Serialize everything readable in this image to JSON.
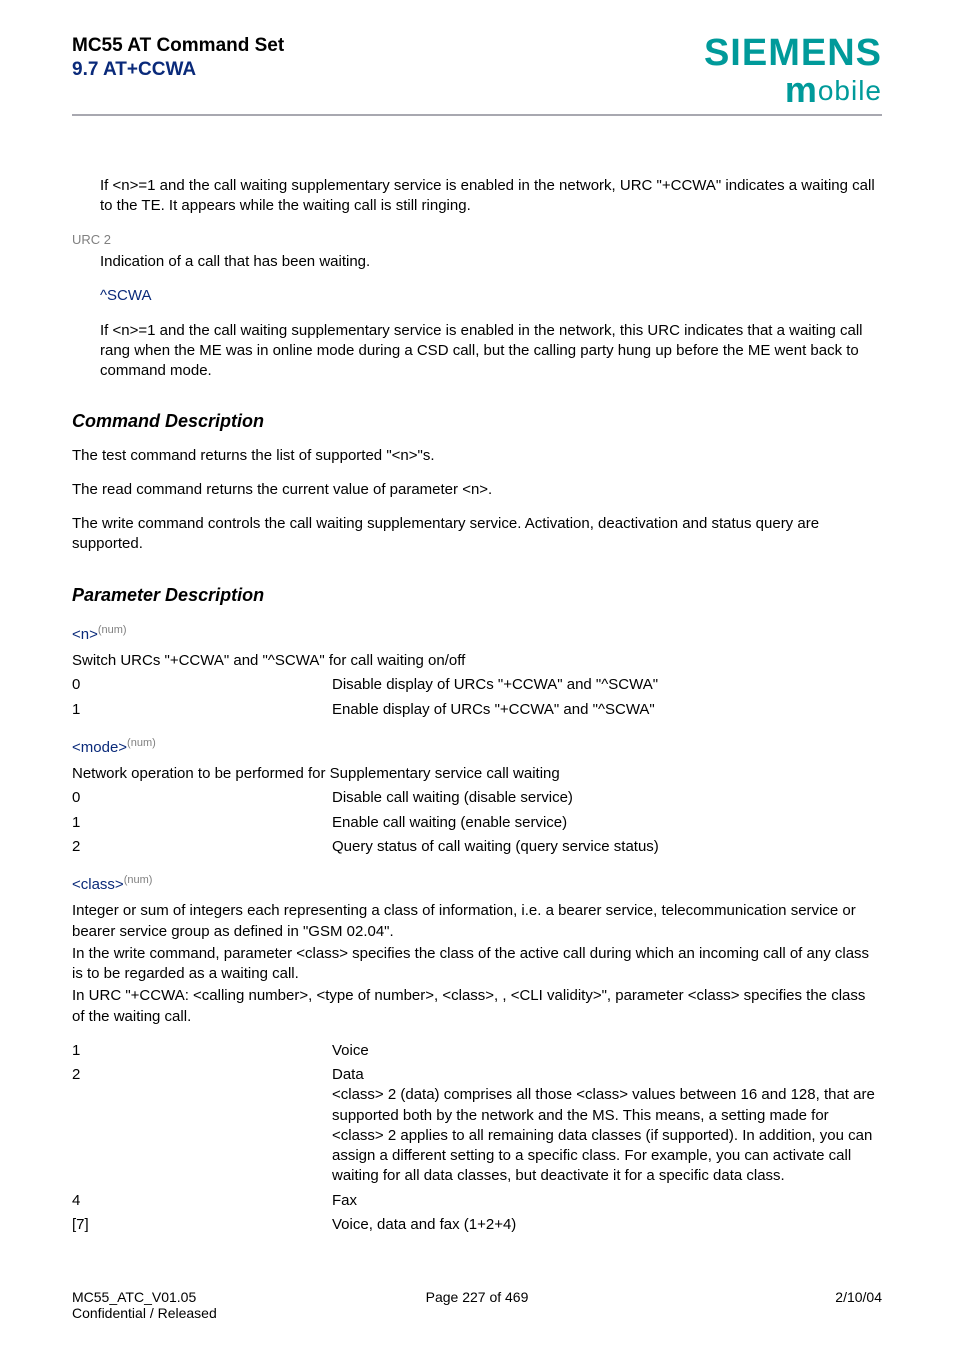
{
  "header": {
    "title": "MC55 AT Command Set",
    "subtitle": "9.7 AT+CCWA",
    "brand_top": "SIEMENS",
    "brand_bottom_m": "m",
    "brand_bottom_rest": "obile"
  },
  "intro_indent": "If <n>=1 and the call waiting supplementary service is enabled in the network, URC \"+CCWA\" indicates a waiting call to the TE. It appears while the waiting call is still ringing.",
  "urc2_label": "URC 2",
  "urc2_line": "Indication of a call that has been waiting.",
  "urc2_format": "^SCWA",
  "urc2_para": "If <n>=1 and the call waiting supplementary service is enabled in the network, this URC indicates that a waiting call rang when the ME was in online mode during a CSD call, but the calling party hung up before the ME went back to command mode.",
  "cmd_desc_h": "Command Description",
  "cmd_desc_p1": "The test command returns the list of supported \"<n>\"s.",
  "cmd_desc_p2": "The read command returns the current value of parameter <n>.",
  "cmd_desc_p3": "The write command controls the call waiting supplementary service. Activation, deactivation and status query are supported.",
  "param_desc_h": "Parameter Description",
  "params": {
    "n": {
      "name": "<n>",
      "sup": "(num)",
      "intro": "Switch URCs \"+CCWA\" and \"^SCWA\" for call waiting on/off",
      "rows": [
        {
          "k": "0",
          "v": "Disable display of URCs \"+CCWA\" and \"^SCWA\""
        },
        {
          "k": "1",
          "v": "Enable display of URCs \"+CCWA\" and \"^SCWA\""
        }
      ]
    },
    "mode": {
      "name": "<mode>",
      "sup": "(num)",
      "intro": "Network operation to be performed for Supplementary service call waiting",
      "rows": [
        {
          "k": "0",
          "v": "Disable call waiting (disable service)"
        },
        {
          "k": "1",
          "v": "Enable call waiting (enable service)"
        },
        {
          "k": "2",
          "v": "Query status of call waiting (query service status)"
        }
      ]
    },
    "class": {
      "name": "<class>",
      "sup": "(num)",
      "para1": "Integer or sum of integers each representing a class of information, i.e. a bearer service, telecommunication service or bearer service group as defined in \"GSM 02.04\".",
      "para2": "In the write command, parameter <class> specifies the class of the active call during which an incoming call of any class is to be regarded as a waiting call.",
      "para3": "In URC \"+CCWA: <calling number>, <type of number>, <class>, , <CLI validity>\", parameter <class> specifies the class of the waiting call.",
      "rows": [
        {
          "k": "1",
          "v": "Voice"
        },
        {
          "k": "2",
          "v": "Data\n<class> 2 (data) comprises all those <class> values between 16 and 128, that are supported both by the network and the MS. This means, a setting made for <class> 2 applies to all remaining data classes (if supported). In addition, you can assign a different setting to a specific class. For example, you can activate call waiting for all data classes, but deactivate it for a specific data class."
        },
        {
          "k": "4",
          "v": "Fax"
        },
        {
          "k": "[7]",
          "v": "Voice, data and fax (1+2+4)"
        }
      ]
    }
  },
  "footer": {
    "left1": "MC55_ATC_V01.05",
    "left2": "Confidential / Released",
    "center": "Page 227 of 469",
    "right": "2/10/04"
  }
}
